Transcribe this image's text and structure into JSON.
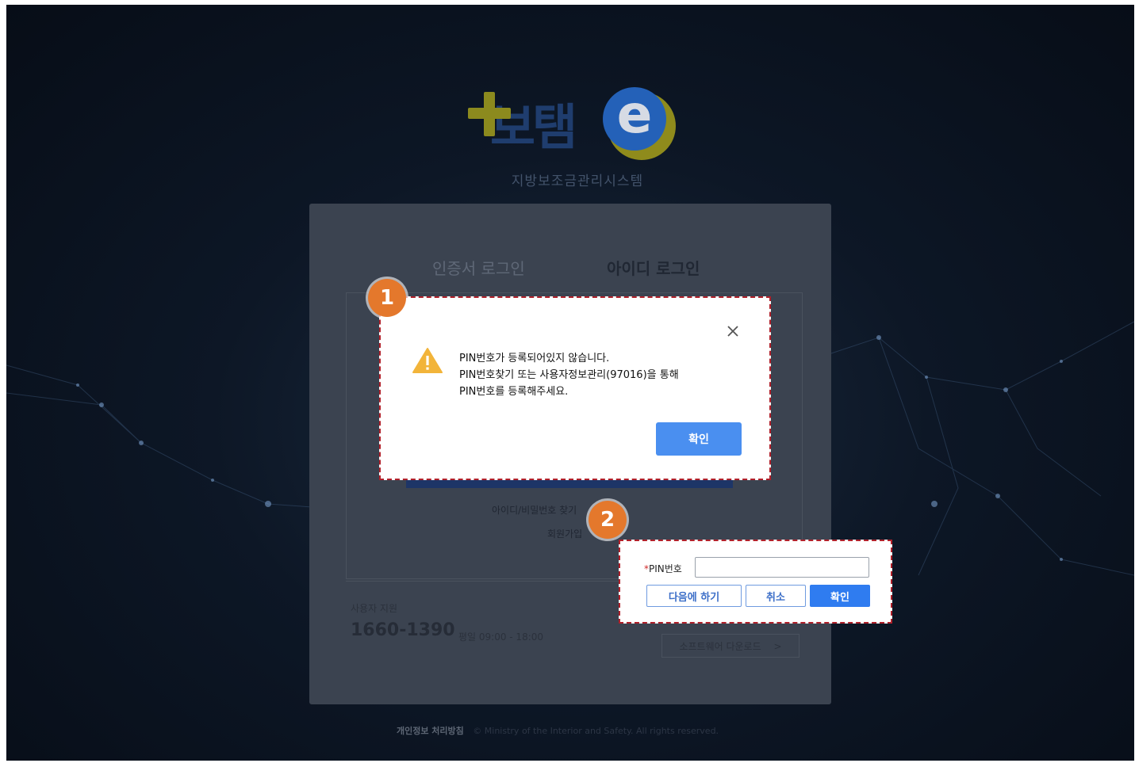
{
  "logo": {
    "plus_glyph": "+",
    "title_text": "보탬",
    "e_glyph": "e",
    "subtitle": "지방보조금관리시스템"
  },
  "login": {
    "tabs": [
      {
        "label": "인증서 로그인"
      },
      {
        "label": "아이디 로그인"
      }
    ],
    "find_link": "아이디/비밀번호 찾기",
    "join_link": "회원가입",
    "support": {
      "label": "사용자 지원",
      "phone": "1660-1390",
      "hours": "평일 09:00 - 18:00"
    },
    "download_label": "소프트웨어 다운로드",
    "download_chevron": ">"
  },
  "footer": {
    "privacy": "개인정보 처리방침",
    "copyright": "© Ministry of the Interior and Safety. All rights reserved."
  },
  "alert_modal": {
    "badge": "1",
    "close_glyph": "×",
    "icon": "warning-icon",
    "lines": [
      "PIN번호가 등록되어있지 않습니다.",
      "PIN번호찾기 또는 사용자정보관리(97016)을 통해",
      "PIN번호를 등록해주세요."
    ],
    "ok_label": "확인"
  },
  "pin_modal": {
    "badge": "2",
    "required_mark": "*",
    "label": "PIN번호",
    "input_value": "",
    "later_label": "다음에 하기",
    "cancel_label": "취소",
    "confirm_label": "확인"
  },
  "colors": {
    "accent_orange": "#e4782c",
    "highlight_red": "#b0202a",
    "primary_blue": "#2f7cf0"
  }
}
